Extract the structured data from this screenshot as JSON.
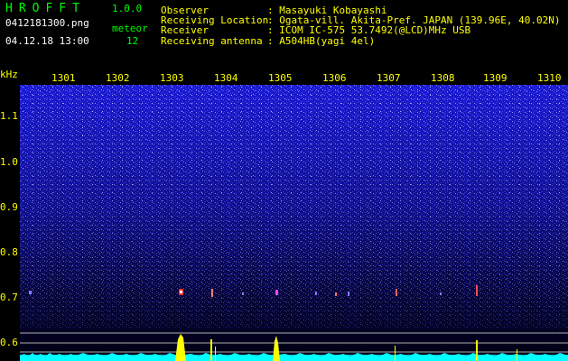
{
  "header": {
    "logo": "HROFFT",
    "version": "1.0.0",
    "filename": "0412181300.png",
    "datetime": "04.12.18 13:00",
    "meteor_label": "meteor",
    "meteor_count": "12",
    "fields": [
      {
        "label": "Observer",
        "value": ": Masayuki Kobayashi"
      },
      {
        "label": "Receiving Location",
        "value": ": Ogata-vill. Akita-Pref. JAPAN (139.96E, 40.02N)"
      },
      {
        "label": "Receiver",
        "value": ": ICOM IC-575 53.7492(@LCD)MHz USB"
      },
      {
        "label": "Receiving antenna",
        "value": ": A504HB(yagi 4el)"
      }
    ]
  },
  "axes": {
    "y_unit": "kHz",
    "y_ticks": [
      "1.1",
      "1.0",
      "0.9",
      "0.8",
      "0.7",
      "0.6"
    ],
    "x_ticks": [
      "1301",
      "1302",
      "1303",
      "1304",
      "1305",
      "1306",
      "1307",
      "1308",
      "1309",
      "1310"
    ]
  },
  "colors": {
    "axis_text": "#ffff00",
    "header_label": "#ffff00",
    "header_value": "#ffff00",
    "logo": "#00ff00",
    "noise": "#2a2aff",
    "background_dark": "#000018",
    "spectrum": "#00ffff",
    "meteor_peak": "#ffff00"
  }
}
